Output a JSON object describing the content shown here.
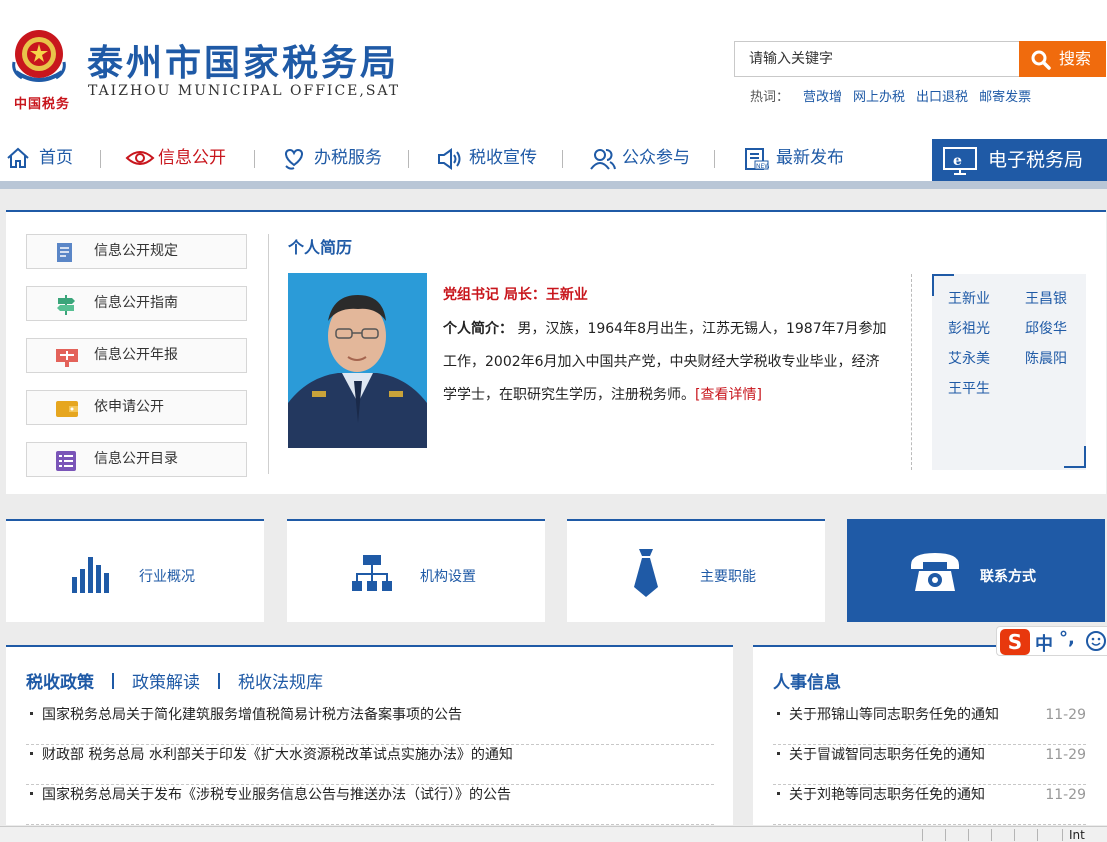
{
  "header": {
    "emblem_text": "中国税务",
    "title": "泰州市国家税务局",
    "subtitle": "TAIZHOU MUNICIPAL OFFICE,SAT",
    "search_placeholder": "请输入关键字",
    "search_button": "搜索",
    "hotwords_label": "热词：",
    "hotwords": [
      "营改增",
      "网上办税",
      "出口退税",
      "邮寄发票"
    ]
  },
  "nav": {
    "items": [
      {
        "label": "首页",
        "icon": "home-icon"
      },
      {
        "label": "信息公开",
        "icon": "eye-icon",
        "active": true
      },
      {
        "label": "办税服务",
        "icon": "heart-hand-icon"
      },
      {
        "label": "税收宣传",
        "icon": "speaker-icon"
      },
      {
        "label": "公众参与",
        "icon": "people-icon"
      },
      {
        "label": "最新发布",
        "icon": "new-doc-icon"
      }
    ],
    "etax_label": "电子税务局"
  },
  "sidebar": {
    "items": [
      {
        "label": "信息公开规定",
        "icon": "document-icon"
      },
      {
        "label": "信息公开指南",
        "icon": "signpost-icon"
      },
      {
        "label": "信息公开年报",
        "icon": "report-icon"
      },
      {
        "label": "依申请公开",
        "icon": "wallet-icon"
      },
      {
        "label": "信息公开目录",
        "icon": "list-icon"
      }
    ]
  },
  "profile": {
    "heading": "个人简历",
    "leader_title": "党组书记 局长：王新业",
    "bio_label": "个人简介：",
    "bio_text": " 男，汉族，1964年8月出生，江苏无锡人，1987年7月参加工作，2002年6月加入中国共产党，中央财经大学税收专业毕业，经济学学士，在职研究生学历，注册税务师。",
    "more_link": "[查看详情]",
    "leaders": [
      "王新业",
      "王昌银",
      "彭祖光",
      "邱俊华",
      "艾永美",
      "陈晨阳",
      "王平生"
    ]
  },
  "tiles": [
    {
      "label": "行业概况",
      "icon": "bar-chart-icon"
    },
    {
      "label": "机构设置",
      "icon": "org-chart-icon"
    },
    {
      "label": "主要职能",
      "icon": "tie-icon"
    },
    {
      "label": "联系方式",
      "icon": "telephone-icon"
    }
  ],
  "policy": {
    "tabs": [
      "税收政策",
      "政策解读",
      "税收法规库"
    ],
    "items": [
      "国家税务总局关于简化建筑服务增值税简易计税方法备案事项的公告",
      "财政部 税务总局 水利部关于印发《扩大水资源税改革试点实施办法》的通知",
      "国家税务总局关于发布《涉税专业服务信息公告与推送办法（试行）》的公告"
    ]
  },
  "personnel": {
    "title": "人事信息",
    "items": [
      {
        "text": "关于邢锦山等同志职务任免的通知",
        "date": "11-29"
      },
      {
        "text": "关于冒诚智同志职务任免的通知",
        "date": "11-29"
      },
      {
        "text": "关于刘艳等同志职务任免的通知",
        "date": "11-29"
      }
    ]
  },
  "ime": {
    "s_label": "S",
    "zh_label": "中",
    "punct_label": "°,"
  },
  "statusbar": {
    "zone_label": "Int"
  },
  "colors": {
    "brand_blue": "#1f5aa6",
    "accent_orange": "#f06b0d",
    "active_red": "#c8161d"
  }
}
